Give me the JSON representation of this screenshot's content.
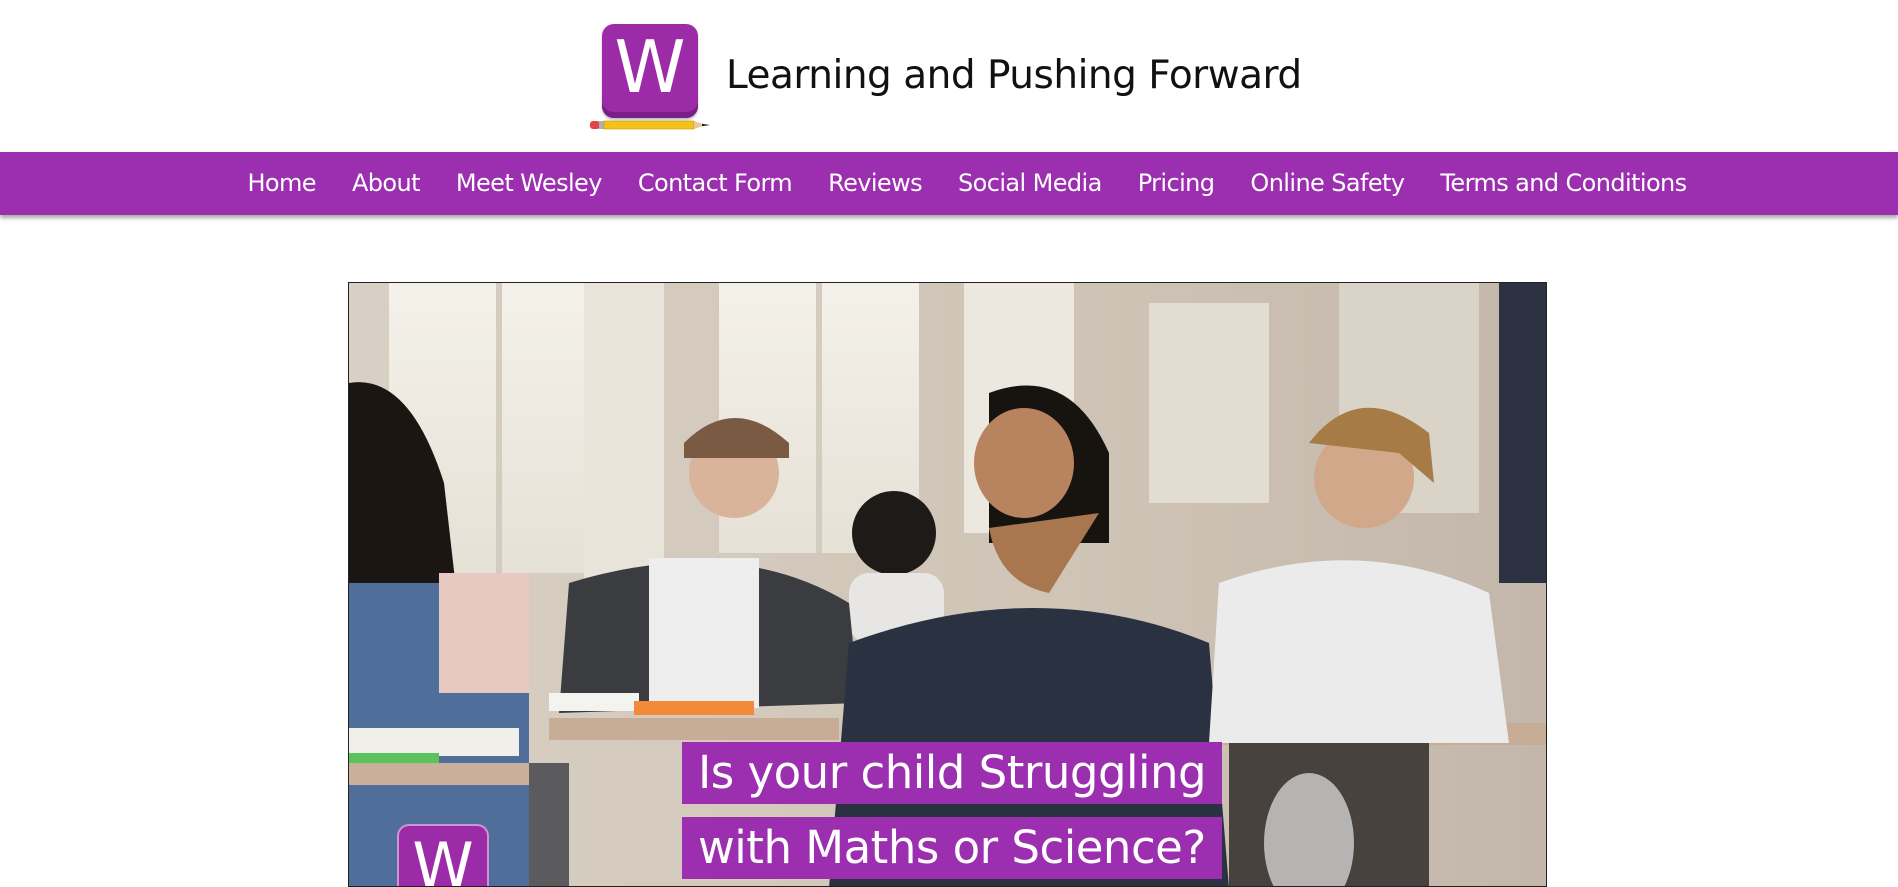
{
  "header": {
    "logo_letter": "W",
    "title": "Learning and Pushing Forward"
  },
  "nav": {
    "items": [
      {
        "label": "Home"
      },
      {
        "label": "About"
      },
      {
        "label": "Meet Wesley"
      },
      {
        "label": "Contact Form"
      },
      {
        "label": "Reviews"
      },
      {
        "label": "Social Media"
      },
      {
        "label": "Pricing"
      },
      {
        "label": "Online Safety"
      },
      {
        "label": "Terms and Conditions"
      }
    ]
  },
  "hero": {
    "caption_line1": "Is your child Struggling",
    "caption_line2": "with Maths or Science?",
    "badge_letter": "W"
  },
  "colors": {
    "brand_purple": "#9b2fb0",
    "logo_purple": "#9c2ba8",
    "pencil_yellow": "#f2c21b"
  },
  "icons": {
    "logo": "w-logo-icon",
    "pencil": "pencil-icon"
  }
}
